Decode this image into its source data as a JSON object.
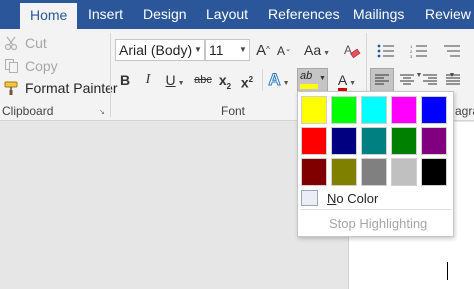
{
  "tabs": [
    {
      "label": "Home",
      "active": true
    },
    {
      "label": "Insert"
    },
    {
      "label": "Design"
    },
    {
      "label": "Layout"
    },
    {
      "label": "References"
    },
    {
      "label": "Mailings"
    },
    {
      "label": "Review"
    }
  ],
  "clipboard": {
    "cut_label": "Cut",
    "copy_label": "Copy",
    "format_painter_label": "Format Painter",
    "group_label": "Clipboard",
    "launcher_icon": "dialog-launcher-icon"
  },
  "font": {
    "font_name": "Arial (Body)",
    "font_size": "11",
    "grow_label": "A",
    "shrink_label": "A",
    "case_label": "Aa",
    "bold_label": "B",
    "italic_label": "I",
    "underline_label": "U",
    "strike_label": "abc",
    "subscript_label": "x",
    "subscript_sub": "2",
    "superscript_label": "x",
    "superscript_sup": "2",
    "effects_label": "A",
    "highlight_label": "ab",
    "font_color_label": "A",
    "group_label": "Font",
    "highlight_color": "#ffff00",
    "font_color": "#d00000"
  },
  "paragraph": {
    "group_label_partial": "agra"
  },
  "highlight_menu": {
    "swatches": [
      "#ffff00",
      "#00ff00",
      "#00ffff",
      "#ff00ff",
      "#0000ff",
      "#ff0000",
      "#000080",
      "#008080",
      "#008000",
      "#800080",
      "#800000",
      "#808000",
      "#808080",
      "#c0c0c0",
      "#000000"
    ],
    "no_color_label_u": "N",
    "no_color_label_rest": "o Color",
    "stop_label": "Stop Highlighting"
  },
  "colors": {
    "tabbar": "#2b579a",
    "ribbon": "#f3f3f3"
  }
}
